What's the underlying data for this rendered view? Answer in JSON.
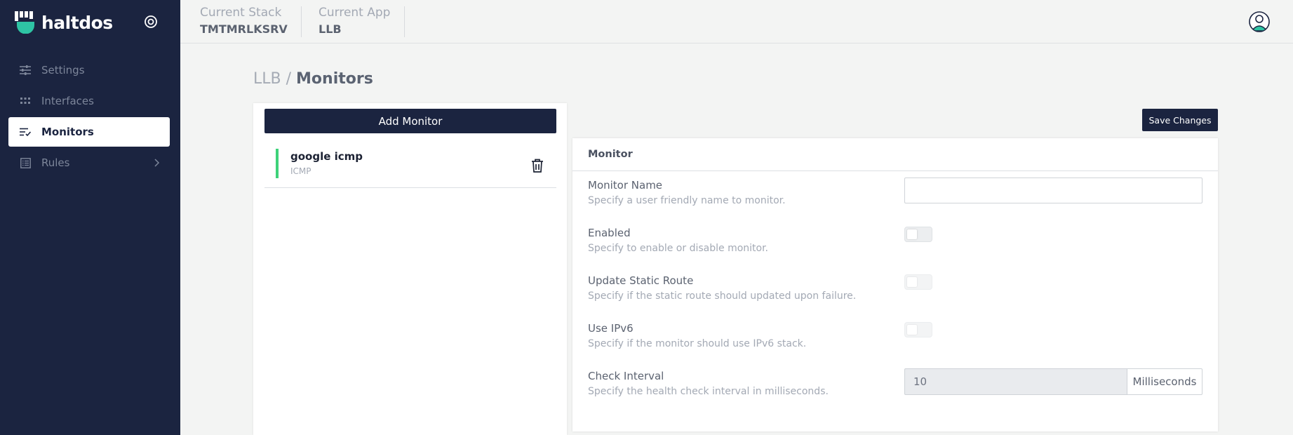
{
  "brand": {
    "name": "haltdos"
  },
  "sidebar": {
    "items": [
      {
        "label": "Settings",
        "icon": "sliders-icon"
      },
      {
        "label": "Interfaces",
        "icon": "grid-icon"
      },
      {
        "label": "Monitors",
        "icon": "list-check-icon",
        "active": true
      },
      {
        "label": "Rules",
        "icon": "list-box-icon",
        "has_submenu": true
      }
    ]
  },
  "topbar": {
    "stack_label": "Current Stack",
    "stack_value": "TMTMRLKSRV",
    "app_label": "Current App",
    "app_value": "LLB"
  },
  "breadcrumb": {
    "parent": "LLB",
    "separator": "/",
    "current": "Monitors"
  },
  "monitors_panel": {
    "add_label": "Add Monitor",
    "items": [
      {
        "name": "google icmp",
        "type": "ICMP",
        "status_color": "#3ed27a"
      }
    ]
  },
  "save_label": "Save Changes",
  "form": {
    "title": "Monitor",
    "monitor_name": {
      "label": "Monitor Name",
      "hint": "Specify a user friendly name to monitor.",
      "value": ""
    },
    "enabled": {
      "label": "Enabled",
      "hint": "Specify to enable or disable monitor.",
      "value": false
    },
    "update_static_route": {
      "label": "Update Static Route",
      "hint": "Specify if the static route should updated upon failure.",
      "value": false
    },
    "use_ipv6": {
      "label": "Use IPv6",
      "hint": "Specify if the monitor should use IPv6 stack.",
      "value": false
    },
    "check_interval": {
      "label": "Check Interval",
      "hint": "Specify the health check interval in milliseconds.",
      "value": "10",
      "unit": "Milliseconds"
    }
  },
  "colors": {
    "sidebar_bg": "#1b2440",
    "accent": "#1b2440",
    "status_green": "#3ed27a",
    "brand_teal": "#2ec4a4"
  }
}
